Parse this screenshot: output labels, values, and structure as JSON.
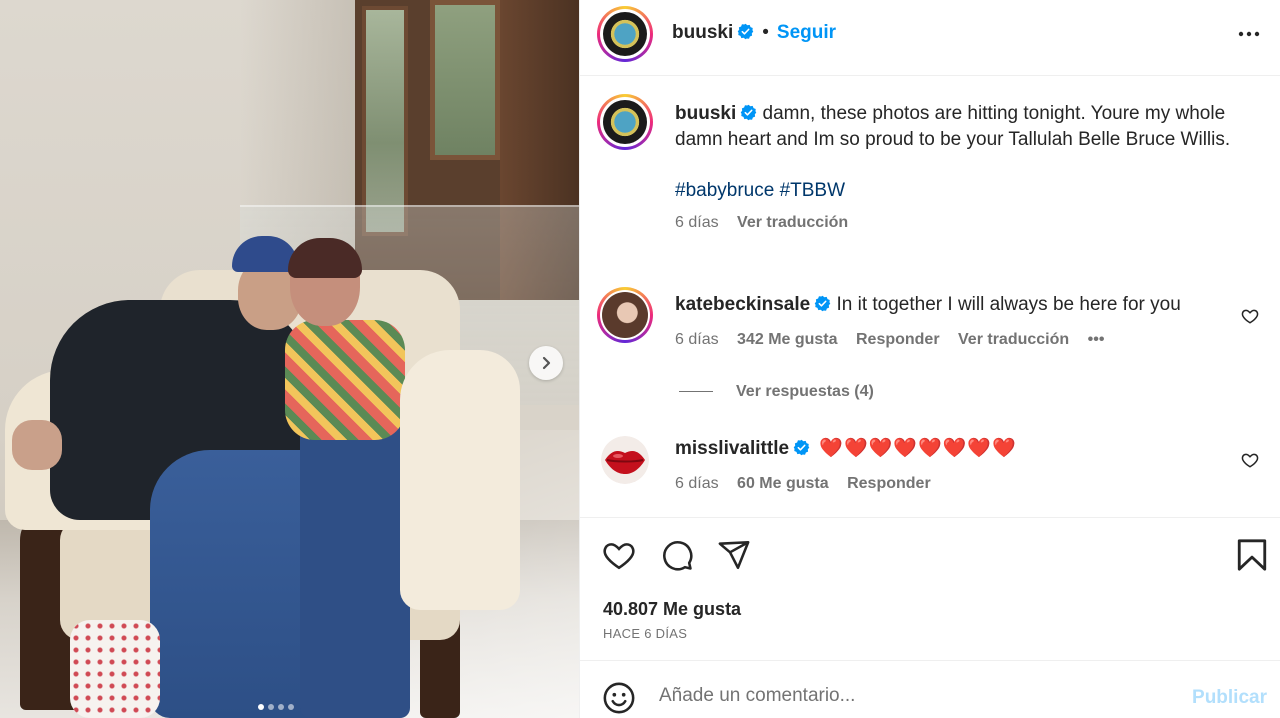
{
  "post": {
    "dots_count": 4,
    "active_dot": 1
  },
  "header": {
    "username": "buuski",
    "separator": "•",
    "follow_label": "Seguir"
  },
  "caption": {
    "username": "buuski",
    "text": " damn, these photos are hitting tonight. Youre my whole damn heart and Im so proud to be your Tallulah Belle Bruce Willis.",
    "hashtags": "#babybruce #TBBW",
    "time": "6 días",
    "translate": "Ver traducción"
  },
  "comments": [
    {
      "username": "katebeckinsale",
      "text": " In it together I will always be here for you",
      "time": "6 días",
      "likes": "342 Me gusta",
      "reply": "Responder",
      "translate": "Ver traducción",
      "more": "•••",
      "view_replies": "Ver respuestas (4)"
    },
    {
      "username": "misslivalittle",
      "text": "❤️❤️❤️❤️❤️❤️❤️❤️",
      "time": "6 días",
      "likes": "60 Me gusta",
      "reply": "Responder"
    }
  ],
  "actions": {
    "likes": "40.807 Me gusta",
    "date": "HACE 6 DÍAS"
  },
  "add_comment": {
    "placeholder": "Añade un comentario...",
    "publish": "Publicar"
  },
  "colors": {
    "accent": "#0095f6",
    "hashtag": "#00376b",
    "muted": "#737373",
    "publish_disabled": "#b2dffc",
    "verified": "#0095f6",
    "heart_red": "#e0364a"
  }
}
